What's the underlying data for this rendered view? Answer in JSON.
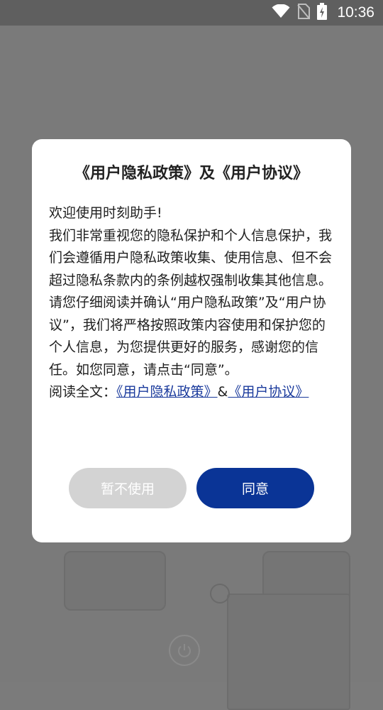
{
  "status_bar": {
    "time": "10:36",
    "icons": [
      "wifi-icon",
      "no-sim-icon",
      "battery-charging-icon"
    ]
  },
  "dialog": {
    "title": "《用户隐私政策》及《用户协议》",
    "paragraphs": [
      "欢迎使用时刻助手!",
      "我们非常重视您的隐私保护和个人信息保护，我们会遵循用户隐私政策收集、使用信息、但不会超过隐私条款内的条例越权强制收集其他信息。",
      "请您仔细阅读并确认“用户隐私政策”及“用户协议”，我们将严格按照政策内容使用和保护您的个人信息，为您提供更好的服务，感谢您的信任。如您同意，请点击“同意”。"
    ],
    "read_full_prefix": "阅读全文：",
    "privacy_link": "《用户隐私政策》",
    "ampersand": "&",
    "agreement_link": "《用户协议》",
    "decline_button": "暂不使用",
    "agree_button": "同意"
  },
  "colors": {
    "agree_button": "#0a3496",
    "decline_button": "#d3d3d3",
    "link": "#1a3a9c",
    "overlay_background": "#7b7b7b"
  }
}
